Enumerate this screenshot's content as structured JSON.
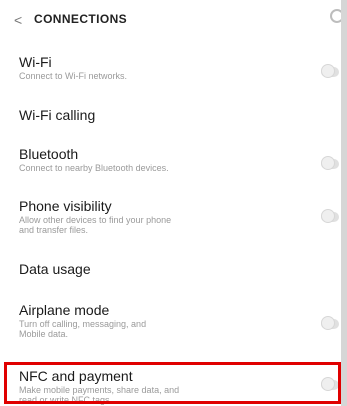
{
  "header": {
    "back_icon": "back-arrow-icon",
    "title": "CONNECTIONS",
    "search_icon": "search-icon"
  },
  "settings": [
    {
      "title": "Wi-Fi",
      "subtitle": "Connect to Wi-Fi networks.",
      "has_toggle": true
    },
    {
      "title": "Wi-Fi calling",
      "subtitle": "",
      "has_toggle": false
    },
    {
      "title": "Bluetooth",
      "subtitle": "Connect to nearby Bluetooth devices.",
      "has_toggle": true
    },
    {
      "title": "Phone visibility",
      "subtitle_line1": "Allow other devices to find your phone",
      "subtitle_line2": "and transfer files.",
      "has_toggle": true
    },
    {
      "title": "Data usage",
      "subtitle": "",
      "has_toggle": false
    },
    {
      "title": "Airplane mode",
      "subtitle_line1": "Turn off calling, messaging, and",
      "subtitle_line2": "Mobile data.",
      "has_toggle": true
    },
    {
      "title": "NFC and payment",
      "subtitle_line1": "Make mobile payments, share data, and",
      "subtitle_line2": "read or write NFC tags.",
      "has_toggle": true
    }
  ],
  "colors": {
    "highlight": "#e00000",
    "toggle_off": "#e0e0e0"
  }
}
